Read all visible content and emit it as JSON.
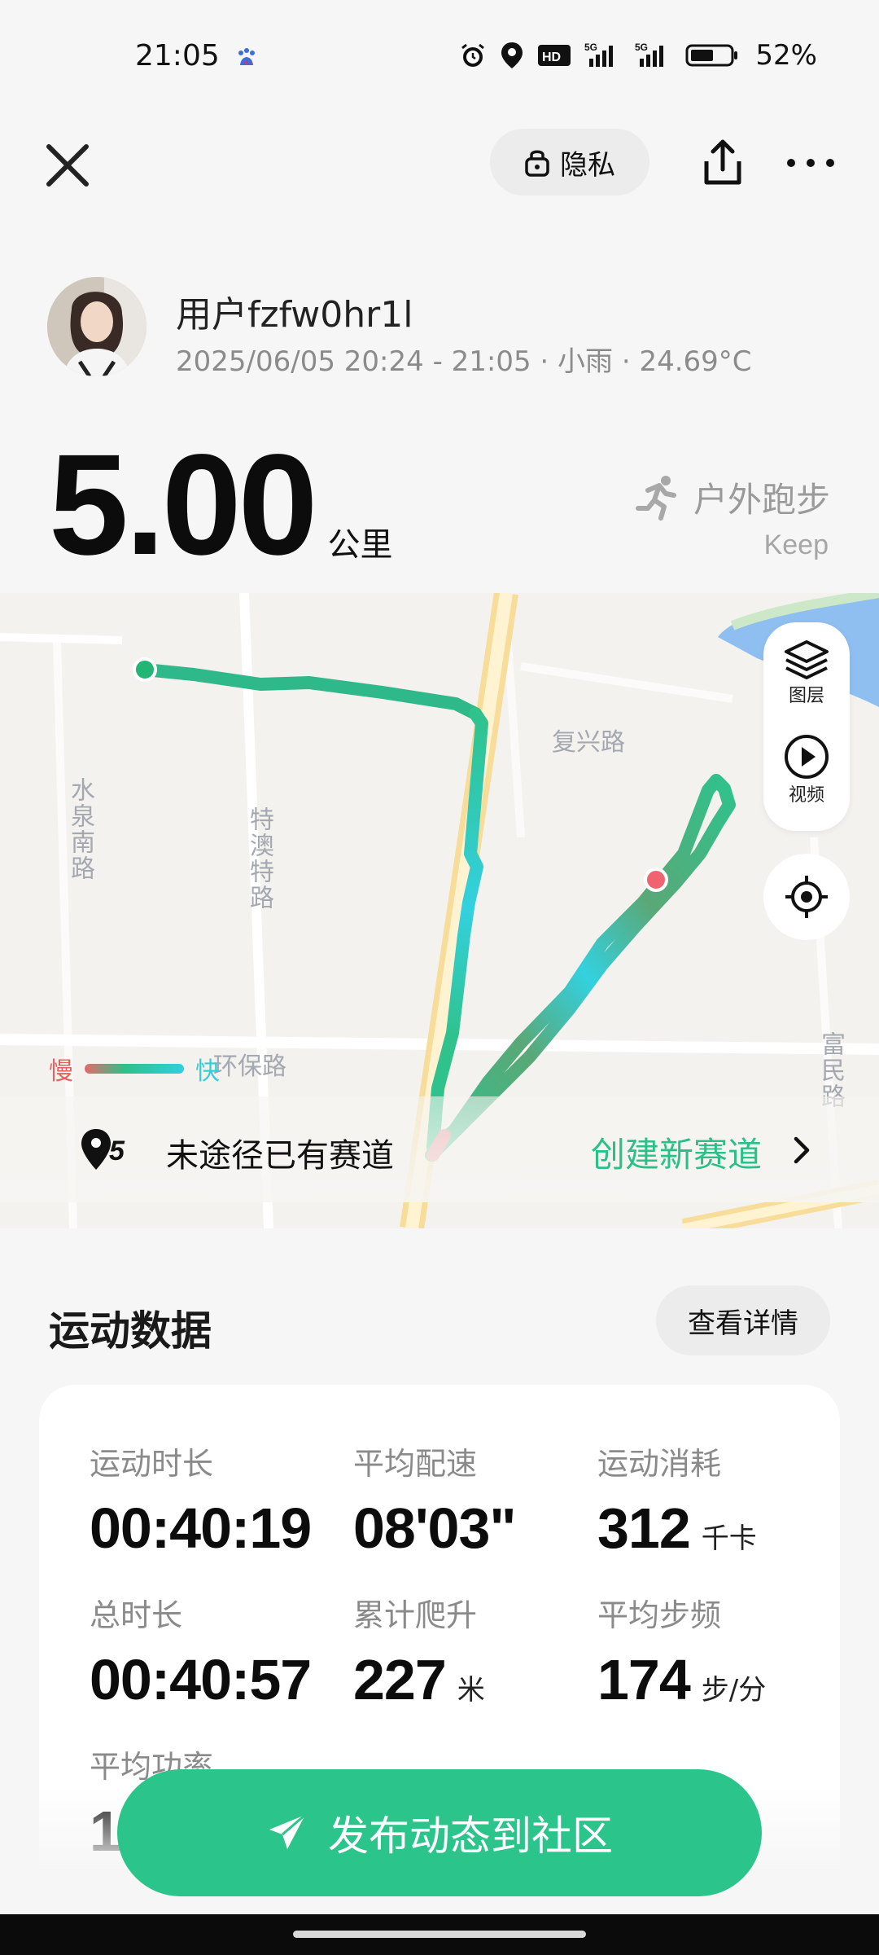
{
  "status_bar": {
    "time": "21:05",
    "battery_percent": "52%",
    "icons": [
      "baidu-icon",
      "alarm-icon",
      "location-icon",
      "hd-icon",
      "signal-5g-icon",
      "signal-5g-icon",
      "battery-icon"
    ]
  },
  "topbar": {
    "privacy_label": "隐私",
    "icons": [
      "close-icon",
      "lock-icon",
      "share-icon",
      "more-icon"
    ]
  },
  "profile": {
    "username": "用户fzfw0hr1l",
    "meta": "2025/06/05 20:24 - 21:05 · 小雨 · 24.69°C"
  },
  "summary": {
    "distance_value": "5.00",
    "distance_unit": "公里",
    "sport_type": "户外跑步",
    "source": "Keep",
    "sport_icon": "running-icon"
  },
  "map": {
    "labels": {
      "road_fuxing": "复兴路",
      "road_shuiquan": "水泉南路",
      "road_teao": "特澳特路",
      "road_huanbao": "环保路",
      "road_fumin": "富民路"
    },
    "controls": {
      "layers_label": "图层",
      "video_label": "视频"
    },
    "legend": {
      "slow": "慢",
      "fast": "快"
    },
    "route_strip": {
      "badge": "5",
      "text": "未途径已有赛道",
      "create": "创建新赛道"
    },
    "colors": {
      "route_green": "#2fc28c",
      "route_cyan": "#33d1e0",
      "start": "#22b573",
      "end": "#f06470",
      "water": "#8fbff0"
    }
  },
  "sport_data": {
    "title": "运动数据",
    "detail_button": "查看详情",
    "stats": [
      {
        "label": "运动时长",
        "value": "00:40:19",
        "unit": ""
      },
      {
        "label": "平均配速",
        "value": "08'03\"",
        "unit": ""
      },
      {
        "label": "运动消耗",
        "value": "312",
        "unit": "千卡"
      },
      {
        "label": "总时长",
        "value": "00:40:57",
        "unit": ""
      },
      {
        "label": "累计爬升",
        "value": "227",
        "unit": "米"
      },
      {
        "label": "平均步频",
        "value": "174",
        "unit": "步/分"
      },
      {
        "label": "平均功率",
        "value": "1",
        "unit": ""
      }
    ]
  },
  "publish": {
    "label": "发布动态到社区",
    "icon": "send-icon"
  }
}
